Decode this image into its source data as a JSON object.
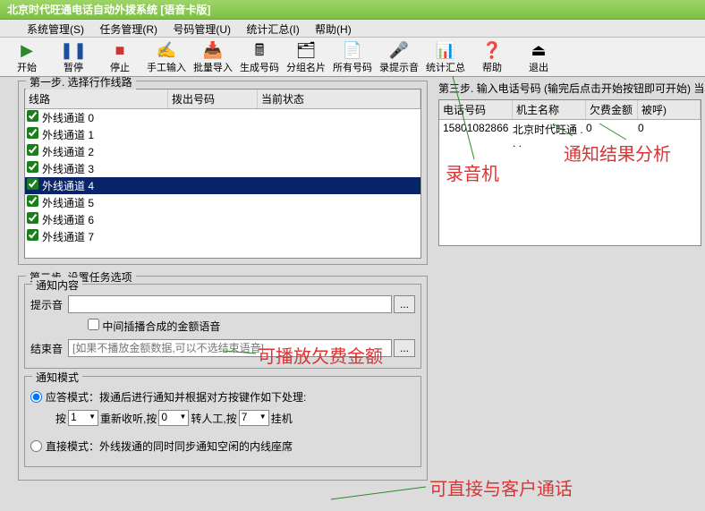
{
  "title": "北京时代旺通电话自动外拨系统 [语音卡版]",
  "menu": {
    "system": "系统管理(S)",
    "task": "任务管理(R)",
    "number": "号码管理(U)",
    "stats": "统计汇总(I)",
    "help": "帮助(H)"
  },
  "toolbar": {
    "start": "开始",
    "pause": "暂停",
    "stop": "停止",
    "manual": "手工输入",
    "batchimport": "批量导入",
    "gennum": "生成号码",
    "groupcard": "分组名片",
    "allnum": "所有号码",
    "recordhint": "录提示音",
    "statsum": "统计汇总",
    "helpbtn": "帮助",
    "exit": "退出"
  },
  "step1": {
    "legend": "第一步. 选择行作线路",
    "cols": {
      "line": "线路",
      "dial": "拨出号码",
      "state": "当前状态"
    },
    "rows": [
      {
        "label": "外线通道 0",
        "sel": false
      },
      {
        "label": "外线通道 1",
        "sel": false
      },
      {
        "label": "外线通道 2",
        "sel": false
      },
      {
        "label": "外线通道 3",
        "sel": false
      },
      {
        "label": "外线通道 4",
        "sel": true
      },
      {
        "label": "外线通道 5",
        "sel": false
      },
      {
        "label": "外线通道 6",
        "sel": false
      },
      {
        "label": "外线通道 7",
        "sel": false
      }
    ]
  },
  "step2": {
    "legend": "第二步. 设置任务选项",
    "content": {
      "legend": "通知内容",
      "prompt_label": "提示音",
      "mid_insert": "中间插播合成的金额语音",
      "end_label": "结束音",
      "end_placeholder": "[如果不播放金额数据,可以不选结束语音]",
      "dots": "..."
    },
    "mode": {
      "legend": "通知模式",
      "answer_mode": "应答模式：拨通后进行通知并根据对方按键作如下处理:",
      "press": "按",
      "n1": "1",
      "redial": "重新收听,按",
      "n0": "0",
      "transfer": "转人工,按",
      "n7": "7",
      "hangup": "挂机",
      "direct_mode": "直接模式：外线拨通的同时同步通知空闲的内线座席"
    }
  },
  "step3": {
    "legend": "第三步. 输入电话号码 (输完后点击开始按钮即可开始) 当前号",
    "cols": {
      "phone": "电话号码",
      "owner": "机主名称",
      "owed": "欠费金额",
      "called": "被呼)"
    },
    "rows": [
      {
        "phone": "15801082866",
        "owner": "北京时代旺通 . . .",
        "owed": "0",
        "called": "0"
      }
    ]
  },
  "annotations": {
    "recorder": "录音机",
    "result": "通知结果分析",
    "playowed": "可播放欠费金额",
    "directcall": "可直接与客户通话"
  }
}
